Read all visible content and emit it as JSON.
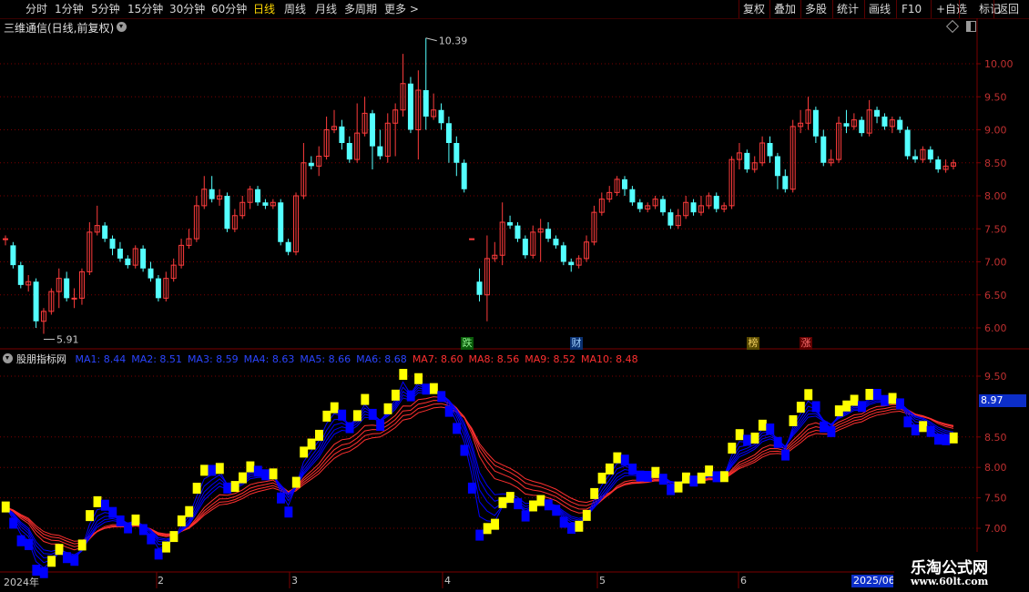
{
  "toolbar": {
    "periods": [
      "分时",
      "1分钟",
      "5分钟",
      "15分钟",
      "30分钟",
      "60分钟",
      "日线",
      "周线",
      "月线",
      "多周期",
      "更多 >"
    ],
    "active_period": "日线",
    "right_buttons": [
      "复权",
      "叠加",
      "多股",
      "统计",
      "画线",
      "F10",
      "+自选",
      "标记",
      "返回"
    ]
  },
  "main_chart": {
    "title": "三维通信(日线,前复权)",
    "y_ticks": [
      "10.00",
      "9.50",
      "9.00",
      "8.50",
      "8.00",
      "7.50",
      "7.00",
      "6.50",
      "6.00"
    ],
    "high_label": "10.39",
    "low_label": "5.91",
    "event_tags": [
      {
        "text": "跌",
        "bg": "#0a5a0a",
        "color": "#8cf08c"
      },
      {
        "text": "财",
        "bg": "#0a3070",
        "color": "#9fd0ff"
      },
      {
        "text": "榜",
        "bg": "#5a4a00",
        "color": "#f0d060"
      },
      {
        "text": "涨",
        "bg": "#600000",
        "color": "#ff7070"
      }
    ]
  },
  "indicator": {
    "name": "股朋指标网",
    "ma_labels": [
      {
        "text": "MA1: 8.44",
        "color": "#2b45ff"
      },
      {
        "text": "MA2: 8.51",
        "color": "#2b45ff"
      },
      {
        "text": "MA3: 8.59",
        "color": "#2b45ff"
      },
      {
        "text": "MA4: 8.63",
        "color": "#2b45ff"
      },
      {
        "text": "MA5: 8.66",
        "color": "#2b45ff"
      },
      {
        "text": "MA6: 8.68",
        "color": "#2b45ff"
      },
      {
        "text": "MA7: 8.60",
        "color": "#ff3030"
      },
      {
        "text": "MA8: 8.56",
        "color": "#ff3030"
      },
      {
        "text": "MA9: 8.52",
        "color": "#ff3030"
      },
      {
        "text": "MA10: 8.48",
        "color": "#ff3030"
      }
    ],
    "y_ticks": [
      "9.50",
      "8.50",
      "8.00",
      "7.50",
      "7.00"
    ],
    "current_value": "8.97"
  },
  "date_axis": [
    "2024年",
    "2",
    "3",
    "4",
    "5",
    "6"
  ],
  "date_highlight": "2025/06",
  "watermark": {
    "line1": "乐淘公式网",
    "line2": "www.60lt.com"
  },
  "colors": {
    "up": "#ff3c3c",
    "down": "#54ffff",
    "yellow": "#ffff00",
    "blue": "#0000ff",
    "grid": "#7a0000",
    "ma_red": "#ff3030"
  },
  "chart_data": {
    "type": "candlestick",
    "ylim": [
      5.8,
      10.4
    ],
    "candles": [
      [
        7.35,
        7.35,
        7.4,
        7.25
      ],
      [
        7.25,
        6.95,
        7.3,
        6.9
      ],
      [
        6.95,
        6.65,
        7.0,
        6.6
      ],
      [
        6.65,
        6.7,
        6.8,
        6.55
      ],
      [
        6.7,
        6.1,
        6.75,
        6.0
      ],
      [
        6.1,
        6.25,
        6.3,
        5.91
      ],
      [
        6.25,
        6.55,
        6.6,
        6.2
      ],
      [
        6.55,
        6.75,
        6.9,
        6.3
      ],
      [
        6.75,
        6.45,
        6.85,
        6.4
      ],
      [
        6.45,
        6.45,
        6.6,
        6.3
      ],
      [
        6.45,
        6.85,
        6.9,
        6.35
      ],
      [
        6.85,
        7.45,
        7.6,
        6.8
      ],
      [
        7.45,
        7.55,
        7.85,
        7.4
      ],
      [
        7.55,
        7.35,
        7.6,
        7.3
      ],
      [
        7.35,
        7.2,
        7.4,
        7.1
      ],
      [
        7.2,
        7.05,
        7.3,
        7.0
      ],
      [
        7.05,
        6.95,
        7.1,
        6.9
      ],
      [
        6.95,
        7.2,
        7.25,
        6.9
      ],
      [
        7.2,
        6.9,
        7.25,
        6.85
      ],
      [
        6.9,
        6.75,
        7.0,
        6.7
      ],
      [
        6.75,
        6.45,
        6.8,
        6.4
      ],
      [
        6.45,
        6.75,
        6.85,
        6.4
      ],
      [
        6.75,
        6.95,
        7.05,
        6.7
      ],
      [
        6.95,
        7.25,
        7.35,
        6.9
      ],
      [
        7.25,
        7.35,
        7.5,
        7.2
      ],
      [
        7.35,
        7.85,
        8.0,
        7.3
      ],
      [
        7.85,
        8.1,
        8.3,
        7.8
      ],
      [
        8.1,
        7.95,
        8.3,
        7.9
      ],
      [
        7.95,
        8.0,
        8.1,
        7.85
      ],
      [
        8.0,
        7.5,
        8.05,
        7.45
      ],
      [
        7.5,
        7.7,
        7.8,
        7.45
      ],
      [
        7.7,
        7.9,
        8.0,
        7.65
      ],
      [
        7.9,
        8.1,
        8.15,
        7.8
      ],
      [
        8.1,
        7.9,
        8.15,
        7.85
      ],
      [
        7.9,
        7.85,
        7.95,
        7.8
      ],
      [
        7.85,
        7.9,
        7.95,
        7.8
      ],
      [
        7.9,
        7.3,
        7.95,
        7.25
      ],
      [
        7.3,
        7.15,
        7.35,
        7.1
      ],
      [
        7.15,
        8.0,
        8.05,
        7.1
      ],
      [
        8.0,
        8.5,
        8.8,
        7.95
      ],
      [
        8.5,
        8.45,
        8.6,
        8.4
      ],
      [
        8.45,
        8.6,
        8.75,
        8.3
      ],
      [
        8.6,
        9.0,
        9.2,
        8.55
      ],
      [
        9.0,
        9.05,
        9.3,
        8.95
      ],
      [
        9.05,
        8.8,
        9.15,
        8.7
      ],
      [
        8.8,
        8.55,
        8.9,
        8.5
      ],
      [
        8.55,
        8.95,
        9.4,
        8.5
      ],
      [
        8.95,
        9.25,
        9.5,
        8.9
      ],
      [
        9.25,
        8.75,
        9.3,
        8.4
      ],
      [
        8.75,
        8.6,
        9.0,
        8.55
      ],
      [
        8.6,
        9.1,
        9.25,
        8.5
      ],
      [
        9.1,
        9.3,
        9.4,
        8.6
      ],
      [
        9.3,
        9.7,
        10.15,
        9.2
      ],
      [
        9.7,
        9.0,
        9.8,
        8.95
      ],
      [
        9.0,
        9.6,
        9.9,
        8.55
      ],
      [
        9.6,
        9.2,
        10.39,
        9.0
      ],
      [
        9.2,
        9.3,
        9.55,
        9.15
      ],
      [
        9.3,
        9.1,
        9.4,
        9.0
      ],
      [
        9.1,
        8.8,
        9.2,
        8.5
      ],
      [
        8.8,
        8.5,
        8.9,
        8.3
      ],
      [
        8.5,
        8.1,
        8.55,
        8.05
      ],
      [
        7.35,
        7.35,
        7.35,
        7.35
      ],
      [
        6.7,
        6.5,
        6.9,
        6.4
      ],
      [
        6.5,
        7.05,
        7.4,
        6.1
      ],
      [
        7.05,
        7.1,
        7.3,
        7.0
      ],
      [
        7.1,
        7.6,
        7.9,
        6.95
      ],
      [
        7.6,
        7.55,
        7.7,
        7.5
      ],
      [
        7.55,
        7.35,
        7.6,
        7.3
      ],
      [
        7.35,
        7.1,
        7.4,
        7.05
      ],
      [
        7.1,
        7.45,
        7.55,
        7.05
      ],
      [
        7.45,
        7.5,
        7.65,
        7.0
      ],
      [
        7.5,
        7.35,
        7.6,
        7.3
      ],
      [
        7.35,
        7.25,
        7.4,
        7.2
      ],
      [
        7.25,
        7.0,
        7.3,
        6.95
      ],
      [
        7.0,
        6.95,
        7.05,
        6.85
      ],
      [
        6.95,
        7.05,
        7.1,
        6.9
      ],
      [
        7.05,
        7.3,
        7.4,
        7.0
      ],
      [
        7.3,
        7.75,
        7.85,
        7.25
      ],
      [
        7.75,
        7.95,
        8.05,
        7.7
      ],
      [
        7.95,
        8.05,
        8.15,
        7.9
      ],
      [
        8.05,
        8.25,
        8.3,
        8.0
      ],
      [
        8.25,
        8.1,
        8.3,
        8.0
      ],
      [
        8.1,
        7.9,
        8.15,
        7.85
      ],
      [
        7.9,
        7.8,
        7.95,
        7.75
      ],
      [
        7.8,
        7.85,
        7.9,
        7.75
      ],
      [
        7.85,
        7.95,
        8.0,
        7.8
      ],
      [
        7.95,
        7.75,
        8.0,
        7.7
      ],
      [
        7.75,
        7.55,
        7.8,
        7.5
      ],
      [
        7.55,
        7.7,
        7.8,
        7.5
      ],
      [
        7.7,
        7.9,
        8.0,
        7.65
      ],
      [
        7.9,
        7.75,
        7.95,
        7.7
      ],
      [
        7.75,
        7.85,
        8.0,
        7.7
      ],
      [
        7.85,
        8.0,
        8.05,
        7.8
      ],
      [
        8.0,
        7.8,
        8.05,
        7.75
      ],
      [
        7.8,
        7.85,
        7.9,
        7.75
      ],
      [
        7.85,
        8.55,
        8.6,
        7.8
      ],
      [
        8.55,
        8.65,
        8.8,
        8.4
      ],
      [
        8.65,
        8.4,
        8.7,
        8.35
      ],
      [
        8.4,
        8.5,
        8.6,
        8.35
      ],
      [
        8.5,
        8.8,
        8.9,
        8.45
      ],
      [
        8.8,
        8.6,
        8.9,
        8.5
      ],
      [
        8.6,
        8.3,
        8.65,
        8.1
      ],
      [
        8.3,
        8.1,
        8.4,
        8.05
      ],
      [
        8.1,
        9.05,
        9.15,
        8.05
      ],
      [
        9.05,
        9.1,
        9.3,
        8.95
      ],
      [
        9.1,
        9.3,
        9.5,
        9.0
      ],
      [
        9.3,
        8.9,
        9.35,
        8.8
      ],
      [
        8.9,
        8.5,
        9.0,
        8.45
      ],
      [
        8.5,
        8.55,
        8.7,
        8.45
      ],
      [
        8.55,
        9.1,
        9.2,
        8.5
      ],
      [
        9.1,
        9.05,
        9.3,
        8.95
      ],
      [
        9.05,
        9.15,
        9.25,
        9.0
      ],
      [
        9.15,
        8.95,
        9.2,
        8.9
      ],
      [
        8.95,
        9.3,
        9.45,
        8.9
      ],
      [
        9.3,
        9.2,
        9.35,
        9.1
      ],
      [
        9.2,
        9.05,
        9.25,
        9.0
      ],
      [
        9.05,
        9.15,
        9.2,
        8.95
      ],
      [
        9.15,
        9.0,
        9.2,
        8.95
      ],
      [
        9.0,
        8.6,
        9.05,
        8.55
      ],
      [
        8.6,
        8.55,
        8.7,
        8.5
      ],
      [
        8.55,
        8.7,
        8.75,
        8.5
      ],
      [
        8.7,
        8.55,
        8.75,
        8.5
      ],
      [
        8.55,
        8.4,
        8.6,
        8.35
      ],
      [
        8.4,
        8.45,
        8.55,
        8.35
      ],
      [
        8.45,
        8.5,
        8.55,
        8.4
      ]
    ]
  }
}
